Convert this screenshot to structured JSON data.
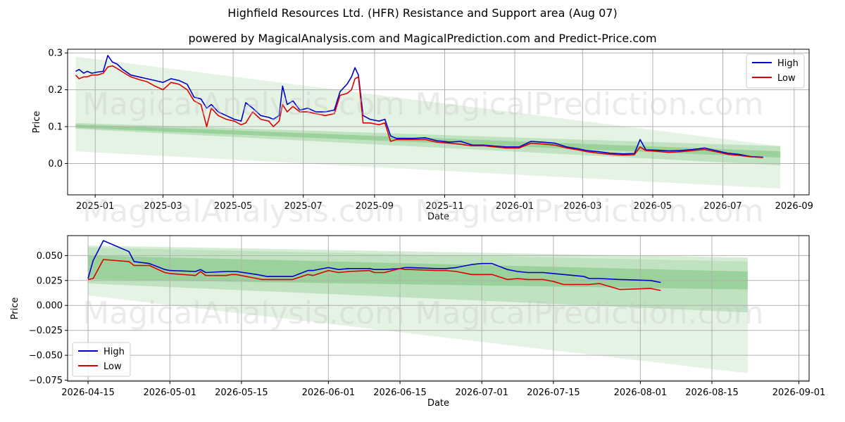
{
  "title": "Highfield Resources Ltd. (HFR) Resistance and Support area (Aug 07)",
  "subtitle": "powered by MagicalAnalysis.com and MagicalPrediction.com and Predict-Price.com",
  "watermarks": [
    "MagicalAnalysis.com",
    "MagicalPrediction.com"
  ],
  "colors": {
    "high": "#0000cc",
    "low": "#dd0000",
    "band": "#2ca02c",
    "grid": "#b0b0b0"
  },
  "chart_data": [
    {
      "type": "line",
      "xlabel": "Date",
      "ylabel": "Price",
      "xlim": [
        "2024-12-08",
        "2026-09-14"
      ],
      "ylim": [
        -0.085,
        0.31
      ],
      "xticks": [
        "2025-01",
        "2025-03",
        "2025-05",
        "2025-07",
        "2025-09",
        "2025-11",
        "2026-01",
        "2026-03",
        "2026-05",
        "2026-07",
        "2026-09"
      ],
      "yticks": [
        0.0,
        0.1,
        0.2,
        0.3
      ],
      "ytick_labels": [
        "0.0",
        "0.1",
        "0.2",
        "0.3"
      ],
      "grid": true,
      "legend": "top-right",
      "bands": [
        {
          "x": [
            "2024-12-15",
            "2026-08-20"
          ],
          "upper": [
            0.29,
            0.047
          ],
          "lower": [
            0.033,
            -0.068
          ],
          "opacity": 0.12
        },
        {
          "x": [
            "2024-12-15",
            "2026-08-20"
          ],
          "upper": [
            0.11,
            0.047
          ],
          "lower": [
            0.094,
            -0.005
          ],
          "opacity": 0.2
        },
        {
          "x": [
            "2024-12-15",
            "2026-08-20"
          ],
          "upper": [
            0.106,
            0.033
          ],
          "lower": [
            0.097,
            0.016
          ],
          "opacity": 0.25
        }
      ],
      "series": [
        {
          "name": "High",
          "x": [
            "2024-12-15",
            "2024-12-18",
            "2024-12-22",
            "2024-12-25",
            "2024-12-29",
            "2025-01-03",
            "2025-01-08",
            "2025-01-12",
            "2025-01-16",
            "2025-01-20",
            "2025-01-25",
            "2025-02-01",
            "2025-02-08",
            "2025-02-15",
            "2025-02-22",
            "2025-03-01",
            "2025-03-08",
            "2025-03-15",
            "2025-03-22",
            "2025-03-28",
            "2025-04-03",
            "2025-04-08",
            "2025-04-12",
            "2025-04-18",
            "2025-04-25",
            "2025-05-02",
            "2025-05-08",
            "2025-05-12",
            "2025-05-18",
            "2025-05-25",
            "2025-06-01",
            "2025-06-05",
            "2025-06-10",
            "2025-06-13",
            "2025-06-17",
            "2025-06-22",
            "2025-06-28",
            "2025-07-05",
            "2025-07-12",
            "2025-07-20",
            "2025-07-28",
            "2025-08-02",
            "2025-08-08",
            "2025-08-12",
            "2025-08-15",
            "2025-08-18",
            "2025-08-22",
            "2025-08-28",
            "2025-09-05",
            "2025-09-10",
            "2025-09-15",
            "2025-09-20",
            "2025-10-05",
            "2025-10-15",
            "2025-10-25",
            "2025-11-05",
            "2025-11-15",
            "2025-11-25",
            "2025-12-05",
            "2025-12-15",
            "2025-12-25",
            "2026-01-05",
            "2026-01-15",
            "2026-01-25",
            "2026-02-05",
            "2026-02-15",
            "2026-02-25",
            "2026-03-05",
            "2026-03-15",
            "2026-03-25",
            "2026-04-05",
            "2026-04-15",
            "2026-04-20",
            "2026-04-25",
            "2026-05-05",
            "2026-05-15",
            "2026-05-25",
            "2026-06-05",
            "2026-06-15",
            "2026-06-25",
            "2026-07-05",
            "2026-07-15",
            "2026-07-25",
            "2026-08-05"
          ],
          "values": [
            0.25,
            0.255,
            0.245,
            0.25,
            0.245,
            0.248,
            0.25,
            0.293,
            0.275,
            0.27,
            0.255,
            0.24,
            0.235,
            0.23,
            0.225,
            0.22,
            0.23,
            0.225,
            0.215,
            0.18,
            0.175,
            0.15,
            0.16,
            0.14,
            0.13,
            0.12,
            0.115,
            0.165,
            0.15,
            0.13,
            0.125,
            0.12,
            0.13,
            0.21,
            0.16,
            0.17,
            0.145,
            0.15,
            0.14,
            0.14,
            0.145,
            0.195,
            0.215,
            0.235,
            0.26,
            0.24,
            0.13,
            0.12,
            0.115,
            0.12,
            0.075,
            0.068,
            0.068,
            0.07,
            0.062,
            0.058,
            0.06,
            0.05,
            0.05,
            0.047,
            0.045,
            0.045,
            0.06,
            0.058,
            0.055,
            0.045,
            0.04,
            0.035,
            0.032,
            0.028,
            0.026,
            0.027,
            0.065,
            0.037,
            0.036,
            0.034,
            0.035,
            0.038,
            0.042,
            0.035,
            0.028,
            0.025,
            0.019,
            0.017
          ]
        },
        {
          "name": "Low",
          "x": [
            "2024-12-15",
            "2024-12-18",
            "2024-12-22",
            "2024-12-25",
            "2024-12-29",
            "2025-01-03",
            "2025-01-08",
            "2025-01-12",
            "2025-01-16",
            "2025-01-20",
            "2025-01-25",
            "2025-02-01",
            "2025-02-08",
            "2025-02-15",
            "2025-02-22",
            "2025-03-01",
            "2025-03-08",
            "2025-03-15",
            "2025-03-22",
            "2025-03-28",
            "2025-04-03",
            "2025-04-08",
            "2025-04-12",
            "2025-04-18",
            "2025-04-25",
            "2025-05-02",
            "2025-05-08",
            "2025-05-12",
            "2025-05-18",
            "2025-05-25",
            "2025-06-01",
            "2025-06-05",
            "2025-06-10",
            "2025-06-13",
            "2025-06-17",
            "2025-06-22",
            "2025-06-28",
            "2025-07-05",
            "2025-07-12",
            "2025-07-20",
            "2025-07-28",
            "2025-08-02",
            "2025-08-08",
            "2025-08-12",
            "2025-08-15",
            "2025-08-18",
            "2025-08-22",
            "2025-08-28",
            "2025-09-05",
            "2025-09-10",
            "2025-09-15",
            "2025-09-20",
            "2025-10-05",
            "2025-10-15",
            "2025-10-25",
            "2025-11-05",
            "2025-11-15",
            "2025-11-25",
            "2025-12-05",
            "2025-12-15",
            "2025-12-25",
            "2026-01-05",
            "2026-01-15",
            "2026-01-25",
            "2026-02-05",
            "2026-02-15",
            "2026-02-25",
            "2026-03-05",
            "2026-03-15",
            "2026-03-25",
            "2026-04-05",
            "2026-04-15",
            "2026-04-20",
            "2026-04-25",
            "2026-05-05",
            "2026-05-15",
            "2026-05-25",
            "2026-06-05",
            "2026-06-15",
            "2026-06-25",
            "2026-07-05",
            "2026-07-15",
            "2026-07-25",
            "2026-08-05"
          ],
          "values": [
            0.24,
            0.23,
            0.235,
            0.235,
            0.24,
            0.24,
            0.245,
            0.262,
            0.265,
            0.258,
            0.248,
            0.235,
            0.228,
            0.222,
            0.21,
            0.2,
            0.22,
            0.215,
            0.2,
            0.17,
            0.16,
            0.1,
            0.15,
            0.13,
            0.12,
            0.115,
            0.105,
            0.11,
            0.14,
            0.12,
            0.115,
            0.1,
            0.115,
            0.16,
            0.14,
            0.155,
            0.14,
            0.14,
            0.135,
            0.13,
            0.135,
            0.185,
            0.19,
            0.2,
            0.23,
            0.235,
            0.11,
            0.11,
            0.105,
            0.11,
            0.06,
            0.065,
            0.065,
            0.065,
            0.058,
            0.055,
            0.052,
            0.048,
            0.048,
            0.045,
            0.042,
            0.042,
            0.055,
            0.053,
            0.05,
            0.042,
            0.037,
            0.032,
            0.028,
            0.025,
            0.023,
            0.024,
            0.045,
            0.035,
            0.033,
            0.03,
            0.032,
            0.035,
            0.038,
            0.032,
            0.025,
            0.022,
            0.018,
            0.016
          ]
        }
      ]
    },
    {
      "type": "line",
      "xlabel": "Date",
      "ylabel": "Price",
      "xlim": [
        "2026-04-11",
        "2026-09-03"
      ],
      "ylim": [
        -0.076,
        0.07
      ],
      "xticks": [
        "2026-04-15",
        "2026-05-01",
        "2026-05-15",
        "2026-06-01",
        "2026-06-15",
        "2026-07-01",
        "2026-07-15",
        "2026-08-01",
        "2026-08-15",
        "2026-09-01"
      ],
      "yticks": [
        0.05,
        0.025,
        0.0,
        -0.025,
        -0.05,
        -0.075
      ],
      "ytick_labels": [
        "0.050",
        "0.025",
        "0.000",
        "−0.025",
        "−0.050",
        "−0.075"
      ],
      "grid": true,
      "legend": "bottom-left",
      "bands": [
        {
          "x": [
            "2026-04-15",
            "2026-08-22"
          ],
          "upper": [
            0.058,
            0.044
          ],
          "lower": [
            0.01,
            -0.068
          ],
          "opacity": 0.12
        },
        {
          "x": [
            "2026-04-15",
            "2026-08-22"
          ],
          "upper": [
            0.06,
            0.048
          ],
          "lower": [
            0.022,
            -0.007
          ],
          "opacity": 0.2
        },
        {
          "x": [
            "2026-04-15",
            "2026-08-22"
          ],
          "upper": [
            0.05,
            0.034
          ],
          "lower": [
            0.026,
            0.016
          ],
          "opacity": 0.25
        }
      ],
      "series": [
        {
          "name": "High",
          "x": [
            "2026-04-15",
            "2026-04-16",
            "2026-04-18",
            "2026-04-23",
            "2026-04-24",
            "2026-04-27",
            "2026-04-30",
            "2026-05-01",
            "2026-05-06",
            "2026-05-07",
            "2026-05-08",
            "2026-05-12",
            "2026-05-13",
            "2026-05-14",
            "2026-05-18",
            "2026-05-19",
            "2026-05-20",
            "2026-05-25",
            "2026-05-28",
            "2026-05-29",
            "2026-06-01",
            "2026-06-03",
            "2026-06-05",
            "2026-06-09",
            "2026-06-10",
            "2026-06-12",
            "2026-06-15",
            "2026-06-16",
            "2026-06-17",
            "2026-06-22",
            "2026-06-24",
            "2026-06-26",
            "2026-06-29",
            "2026-07-01",
            "2026-07-03",
            "2026-07-06",
            "2026-07-08",
            "2026-07-10",
            "2026-07-13",
            "2026-07-15",
            "2026-07-17",
            "2026-07-21",
            "2026-07-22",
            "2026-07-24",
            "2026-07-28",
            "2026-08-03",
            "2026-08-05"
          ],
          "values": [
            0.027,
            0.045,
            0.065,
            0.054,
            0.044,
            0.042,
            0.036,
            0.035,
            0.034,
            0.036,
            0.033,
            0.034,
            0.034,
            0.034,
            0.031,
            0.03,
            0.029,
            0.029,
            0.035,
            0.035,
            0.038,
            0.036,
            0.037,
            0.037,
            0.036,
            0.036,
            0.037,
            0.038,
            0.038,
            0.037,
            0.037,
            0.038,
            0.041,
            0.042,
            0.042,
            0.036,
            0.034,
            0.033,
            0.033,
            0.032,
            0.031,
            0.029,
            0.027,
            0.027,
            0.026,
            0.025,
            0.023
          ]
        },
        {
          "name": "Low",
          "x": [
            "2026-04-15",
            "2026-04-16",
            "2026-04-18",
            "2026-04-23",
            "2026-04-24",
            "2026-04-27",
            "2026-04-30",
            "2026-05-01",
            "2026-05-06",
            "2026-05-07",
            "2026-05-08",
            "2026-05-12",
            "2026-05-13",
            "2026-05-14",
            "2026-05-18",
            "2026-05-19",
            "2026-05-20",
            "2026-05-25",
            "2026-05-28",
            "2026-05-29",
            "2026-06-01",
            "2026-06-03",
            "2026-06-05",
            "2026-06-09",
            "2026-06-10",
            "2026-06-12",
            "2026-06-15",
            "2026-06-16",
            "2026-06-17",
            "2026-06-22",
            "2026-06-24",
            "2026-06-26",
            "2026-06-29",
            "2026-07-01",
            "2026-07-03",
            "2026-07-06",
            "2026-07-08",
            "2026-07-10",
            "2026-07-13",
            "2026-07-15",
            "2026-07-17",
            "2026-07-21",
            "2026-07-22",
            "2026-07-24",
            "2026-07-28",
            "2026-08-03",
            "2026-08-05"
          ],
          "values": [
            0.026,
            0.027,
            0.046,
            0.044,
            0.04,
            0.04,
            0.033,
            0.032,
            0.03,
            0.034,
            0.03,
            0.03,
            0.031,
            0.031,
            0.027,
            0.026,
            0.026,
            0.026,
            0.031,
            0.03,
            0.035,
            0.033,
            0.034,
            0.035,
            0.033,
            0.033,
            0.037,
            0.036,
            0.036,
            0.035,
            0.035,
            0.034,
            0.031,
            0.031,
            0.031,
            0.026,
            0.027,
            0.026,
            0.026,
            0.024,
            0.021,
            0.021,
            0.021,
            0.022,
            0.016,
            0.017,
            0.015
          ]
        }
      ]
    }
  ]
}
